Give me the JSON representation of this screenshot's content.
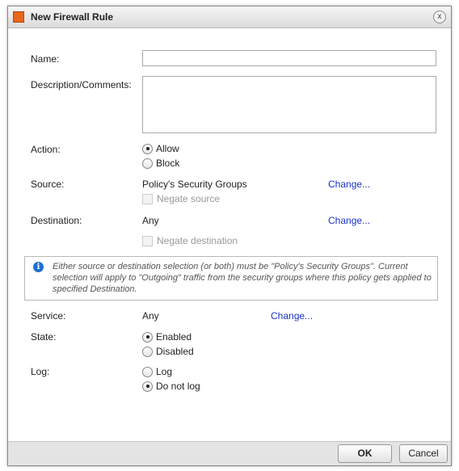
{
  "dialog": {
    "title": "New Firewall Rule",
    "close_symbol": "x",
    "icon": "firewall-icon"
  },
  "form": {
    "name_label": "Name:",
    "name_value": "",
    "description_label": "Description/Comments:",
    "description_value": "",
    "action_label": "Action:",
    "action_options": [
      {
        "label": "Allow",
        "selected": true
      },
      {
        "label": "Block",
        "selected": false
      }
    ],
    "source_label": "Source:",
    "source_value": "Policy's Security Groups",
    "source_change": "Change...",
    "negate_source": "Negate source",
    "destination_label": "Destination:",
    "destination_value": "Any",
    "destination_change": "Change...",
    "negate_destination": "Negate destination",
    "info_text": "Either source or destination selection (or both) must be \"Policy's Security Groups\". Current selection will apply to \"Outgoing\" traffic from the security groups where this policy gets applied to specified Destination.",
    "service_label": "Service:",
    "service_value": "Any",
    "service_change": "Change...",
    "state_label": "State:",
    "state_options": [
      {
        "label": "Enabled",
        "selected": true
      },
      {
        "label": "Disabled",
        "selected": false
      }
    ],
    "log_label": "Log:",
    "log_options": [
      {
        "label": "Log",
        "selected": false
      },
      {
        "label": "Do not log",
        "selected": true
      }
    ]
  },
  "footer": {
    "ok_label": "OK",
    "cancel_label": "Cancel"
  },
  "colors": {
    "link": "#1a33c8",
    "title_icon": "#e8661c",
    "info_icon": "#1f6fd1"
  }
}
